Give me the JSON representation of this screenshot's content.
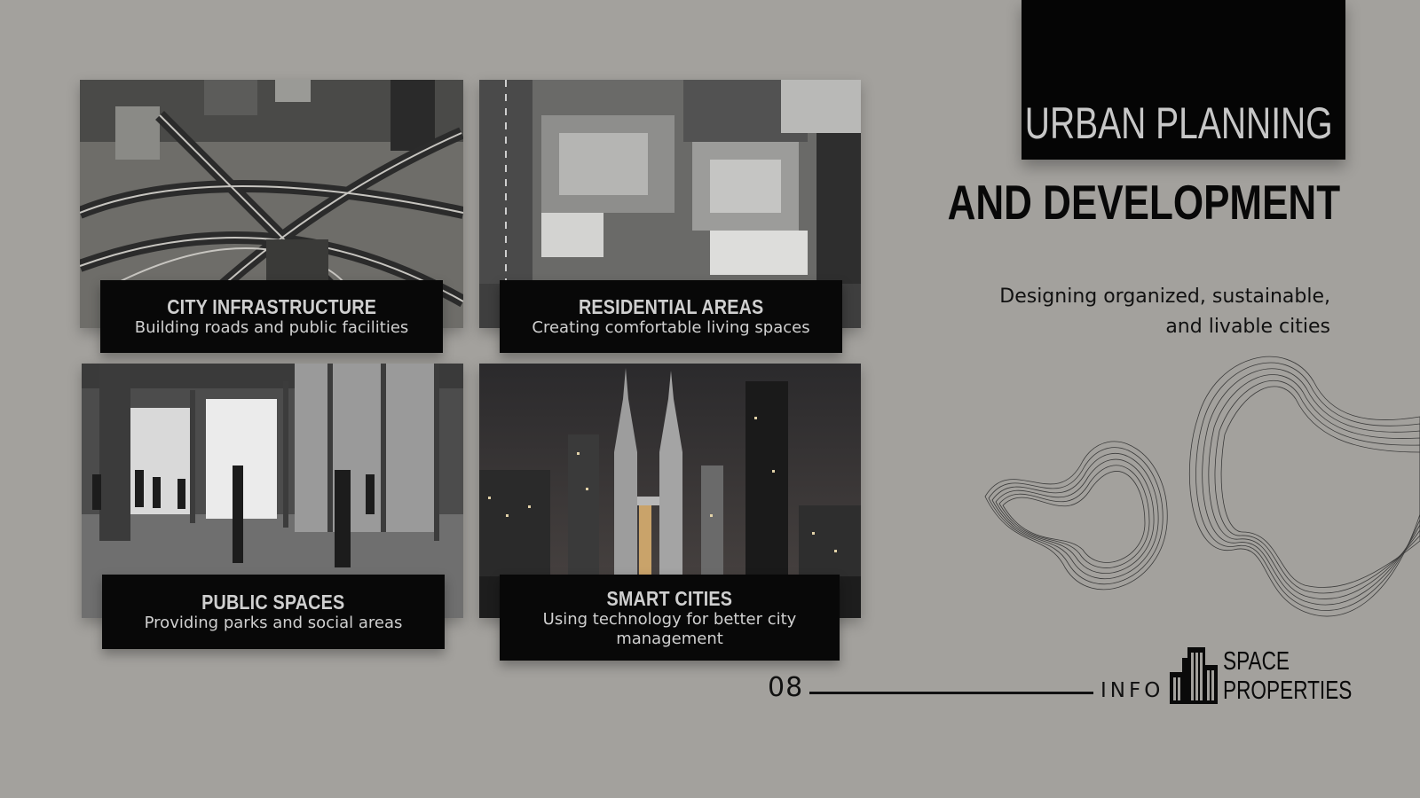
{
  "colors": {
    "background": "#a3a19d",
    "panel": "#080808",
    "text_light": "#c9c9c9",
    "text_dark": "#111111"
  },
  "header": {
    "title_line1": "URBAN PLANNING",
    "title_line2": "AND DEVELOPMENT",
    "subtitle_line1": "Designing organized, sustainable,",
    "subtitle_line2": "and livable cities"
  },
  "cards": [
    {
      "title": "CITY INFRASTRUCTURE",
      "text": "Building roads and public facilities",
      "image": "highway-interchange-photo"
    },
    {
      "title": "RESIDENTIAL AREAS",
      "text": "Creating comfortable living spaces",
      "image": "residential-aerial-photo"
    },
    {
      "title": "PUBLIC SPACES",
      "text": "Providing parks and social areas",
      "image": "public-hall-photo"
    },
    {
      "title": "SMART CITIES",
      "text": "Using technology for better city management",
      "image": "night-skyline-photo"
    }
  ],
  "footer": {
    "page_number": "08",
    "info_label": "INFO",
    "logo_line1": "SPACE",
    "logo_line2": "PROPERTIES",
    "logo_icon": "buildings-icon"
  },
  "decor": {
    "icon": "wave-lines-decoration"
  }
}
